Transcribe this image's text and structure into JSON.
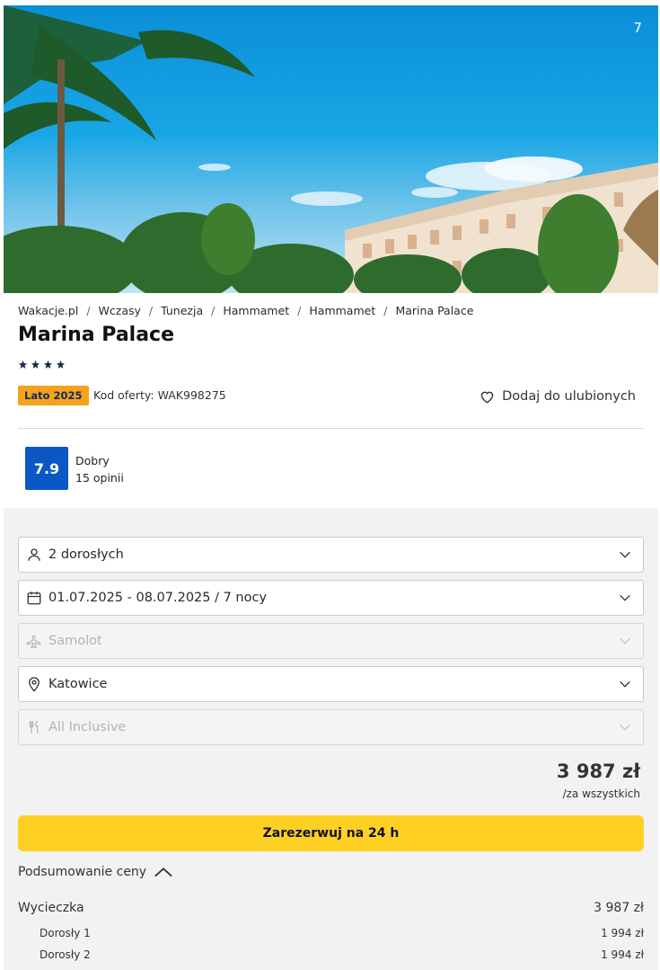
{
  "gallery": {
    "photo_count": "7"
  },
  "breadcrumb": [
    "Wakacje.pl",
    "Wczasy",
    "Tunezja",
    "Hammamet",
    "Hammamet",
    "Marina Palace"
  ],
  "breadcrumb_separator": "/",
  "hotel": {
    "name": "Marina Palace",
    "stars": 4,
    "season_badge": "Lato 2025",
    "offer_code": "Kod oferty: WAK998275",
    "favorite_label": "Dodaj do ulubionych"
  },
  "rating": {
    "score": "7.9",
    "label": "Dobry",
    "reviews": "15 opinii"
  },
  "form": {
    "travelers": "2 dorosłych",
    "dates": "01.07.2025 - 08.07.2025 / 7 nocy",
    "transport": "Samolot",
    "departure": "Katowice",
    "board": "All Inclusive"
  },
  "pricing": {
    "total": "3 987 zł",
    "total_note": "/za wszystkich",
    "book_label": "Zarezerwuj na 24 h",
    "summary_label": "Podsumowanie ceny",
    "lines": [
      {
        "label": "Wycieczka",
        "value": "3 987 zł"
      },
      {
        "label": "Dorosły 1",
        "value": "1 994 zł"
      },
      {
        "label": "Dorosły 2",
        "value": "1 994 zł"
      }
    ]
  },
  "colors": {
    "badge": "#f7a21b",
    "rating": "#0b57c4",
    "book_button": "#ffd024",
    "panel_background": "#f2f2f2"
  }
}
